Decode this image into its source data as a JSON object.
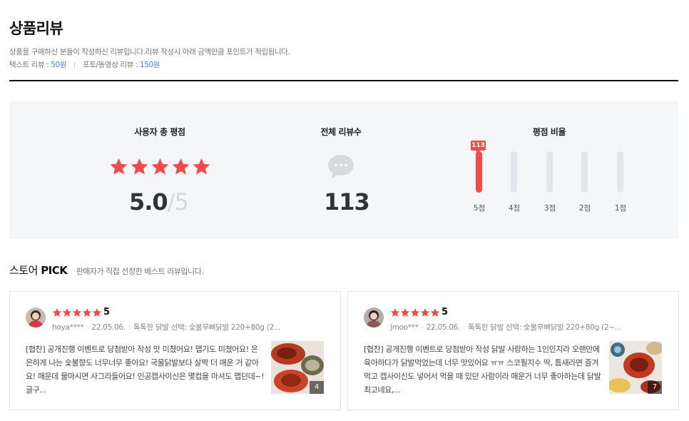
{
  "header": {
    "title": "상품리뷰",
    "description": "상품을 구매하신 분들이 작성하신 리뷰입니다.리뷰 작성시 아래 금액만큼 포인트가 적립됩니다.",
    "text_review_label": "텍스트 리뷰 :",
    "text_review_points": "50원",
    "photo_review_label": "포토/동영상 리뷰 :",
    "photo_review_points": "150원"
  },
  "summary": {
    "avg_label": "사용자 총 평점",
    "avg_score": "5.0",
    "avg_max": "/5",
    "total_label": "전체 리뷰수",
    "total_count": "113",
    "ratio_label": "평점 비율",
    "top_count_tag": "113",
    "distribution": [
      {
        "label": "5점",
        "fraction": 1.0
      },
      {
        "label": "4점",
        "fraction": 0
      },
      {
        "label": "3점",
        "fraction": 0
      },
      {
        "label": "2점",
        "fraction": 0
      },
      {
        "label": "1점",
        "fraction": 0
      }
    ]
  },
  "pick": {
    "title_prefix": "스토어",
    "title_bold": "PICK",
    "subtitle": "판매자가 직접 선정한 베스트 리뷰입니다."
  },
  "reviews": [
    {
      "score": "5",
      "user": "hoya****",
      "date": "22.05.06.",
      "option": "톡톡한 닭발 선택: 숯불무뼈닭발 220+80g (2...",
      "body": "[협찬] 공개진행 이벤트로 당첨받아 작성 맛 미쳤어요! 맵기도 미쳤어요! 은은하게 나는 숯불향도 너무너무 좋아요! 국물닭발보다 살짝 더 매운 거 같아요! 매운데 물마시면 사그라들어요! 인공캡사이신은 몇컵을 마셔도 맵던데~! 글구...",
      "photo_count": "4"
    },
    {
      "score": "5",
      "user": "jmoo***",
      "date": "22.05.06.",
      "option": "톡톡한 닭발 선택: 숯불무뼈닭발 220+80g (2~...",
      "body": "[협찬] 공개진행 이벤트로 당첨받아 작성 닭발 사랑하는 1인인지라 오랜만에 육아하다가 닭발먹었는데 너무 맛있어요 ㅠㅠ 스코필지수 딱, 틈새라면 즐겨먹고 캡사이신도 넣어서 먹을 때 있던 사람이라 매운거 너무 좋아하는데 닭발 최고네요,...",
      "photo_count": "7"
    }
  ],
  "colors": {
    "star": "#f04a4a",
    "accent_blue": "#4d7fd6",
    "summary_bg": "#f5f6f8"
  },
  "icons": {
    "star": "star-icon",
    "bubble": "speech-bubble-icon"
  }
}
